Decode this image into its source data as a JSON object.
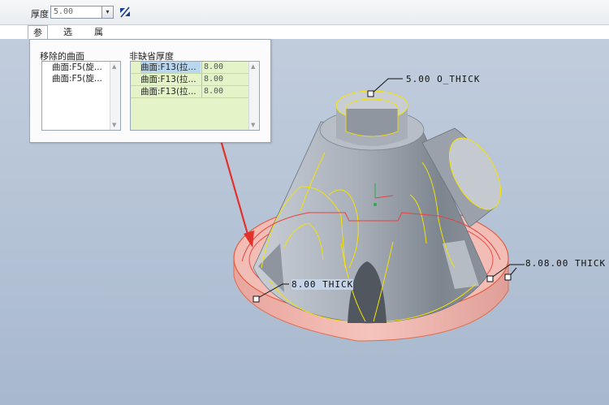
{
  "toolbar": {
    "thickness_label": "厚度",
    "thickness_value": "5.00",
    "dropdown_glyph": "▾",
    "flip_icon": "flip-direction-icon"
  },
  "tabs": [
    {
      "label": "参照",
      "active": true
    },
    {
      "label": "选项",
      "active": false
    },
    {
      "label": "属性",
      "active": false
    }
  ],
  "panel": {
    "removed_surfaces_title": "移除的曲面",
    "removed_surfaces": [
      "曲面:F5(旋...",
      "曲面:F5(旋..."
    ],
    "non_default_title": "非缺省厚度",
    "non_default_thickness": [
      {
        "surface": "曲面:F13(拉...",
        "value": "8.00",
        "selected": true
      },
      {
        "surface": "曲面:F13(拉...",
        "value": "8.00",
        "selected": false
      },
      {
        "surface": "曲面:F13(拉...",
        "value": "8.00",
        "selected": false
      }
    ]
  },
  "annotations": {
    "top": "5.00 O_THICK",
    "left": "8.00 THICK",
    "right": "8.08.00 THICK"
  },
  "colors": {
    "accent_arrow": "#e2312b",
    "model_gray": "#9aa1ab",
    "base_pink": "#f0b8b0",
    "edge_yellow": "#f5e200",
    "list_green": "#e4f4c8"
  }
}
